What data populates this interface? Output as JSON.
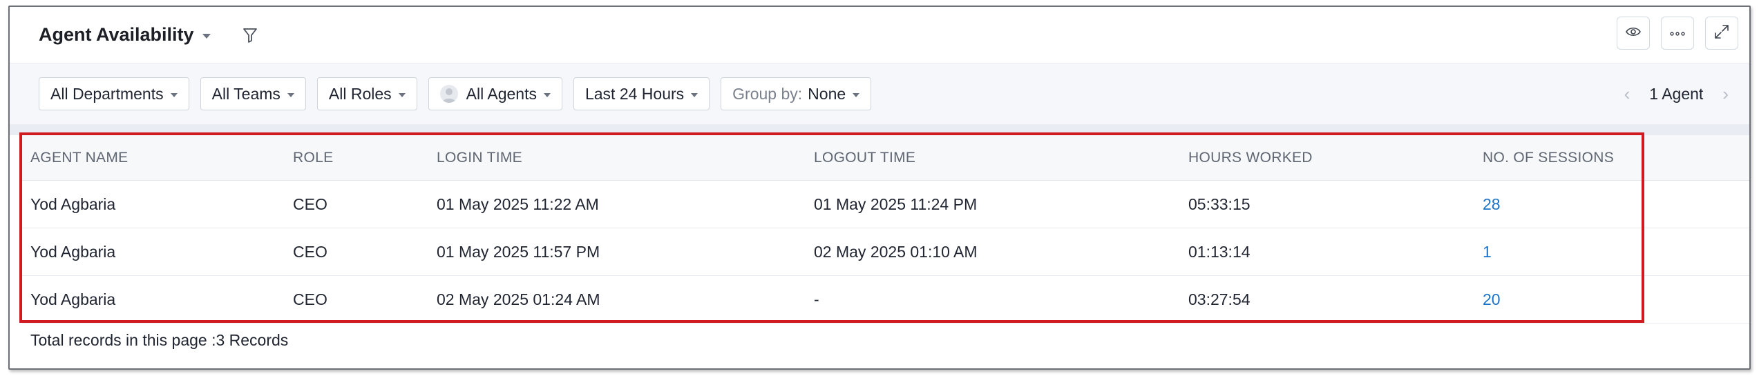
{
  "header": {
    "title": "Agent Availability",
    "icons": [
      "filter-icon",
      "eye-icon",
      "more-icon",
      "expand-icon"
    ]
  },
  "filters": {
    "departments": "All Departments",
    "teams": "All Teams",
    "roles": "All Roles",
    "agents": "All Agents",
    "period": "Last 24 Hours",
    "group_by_label": "Group by:",
    "group_by_value": "None"
  },
  "pager": {
    "count_label": "1 Agent"
  },
  "table": {
    "columns": [
      "AGENT NAME",
      "ROLE",
      "LOGIN TIME",
      "LOGOUT TIME",
      "HOURS WORKED",
      "NO. OF SESSIONS"
    ],
    "rows": [
      [
        "Yod Agbaria",
        "CEO",
        "01 May 2025 11:22 AM",
        "01 May 2025 11:24 PM",
        "05:33:15",
        "28"
      ],
      [
        "Yod Agbaria",
        "CEO",
        "01 May 2025 11:57 PM",
        "02 May 2025 01:10 AM",
        "01:13:14",
        "1"
      ],
      [
        "Yod Agbaria",
        "CEO",
        "02 May 2025 01:24 AM",
        "-",
        "03:27:54",
        "20"
      ]
    ]
  },
  "footer": {
    "total_records": "Total records in this page :3 Records"
  },
  "colors": {
    "link": "#1a73c8",
    "highlight": "#d11a1f"
  }
}
